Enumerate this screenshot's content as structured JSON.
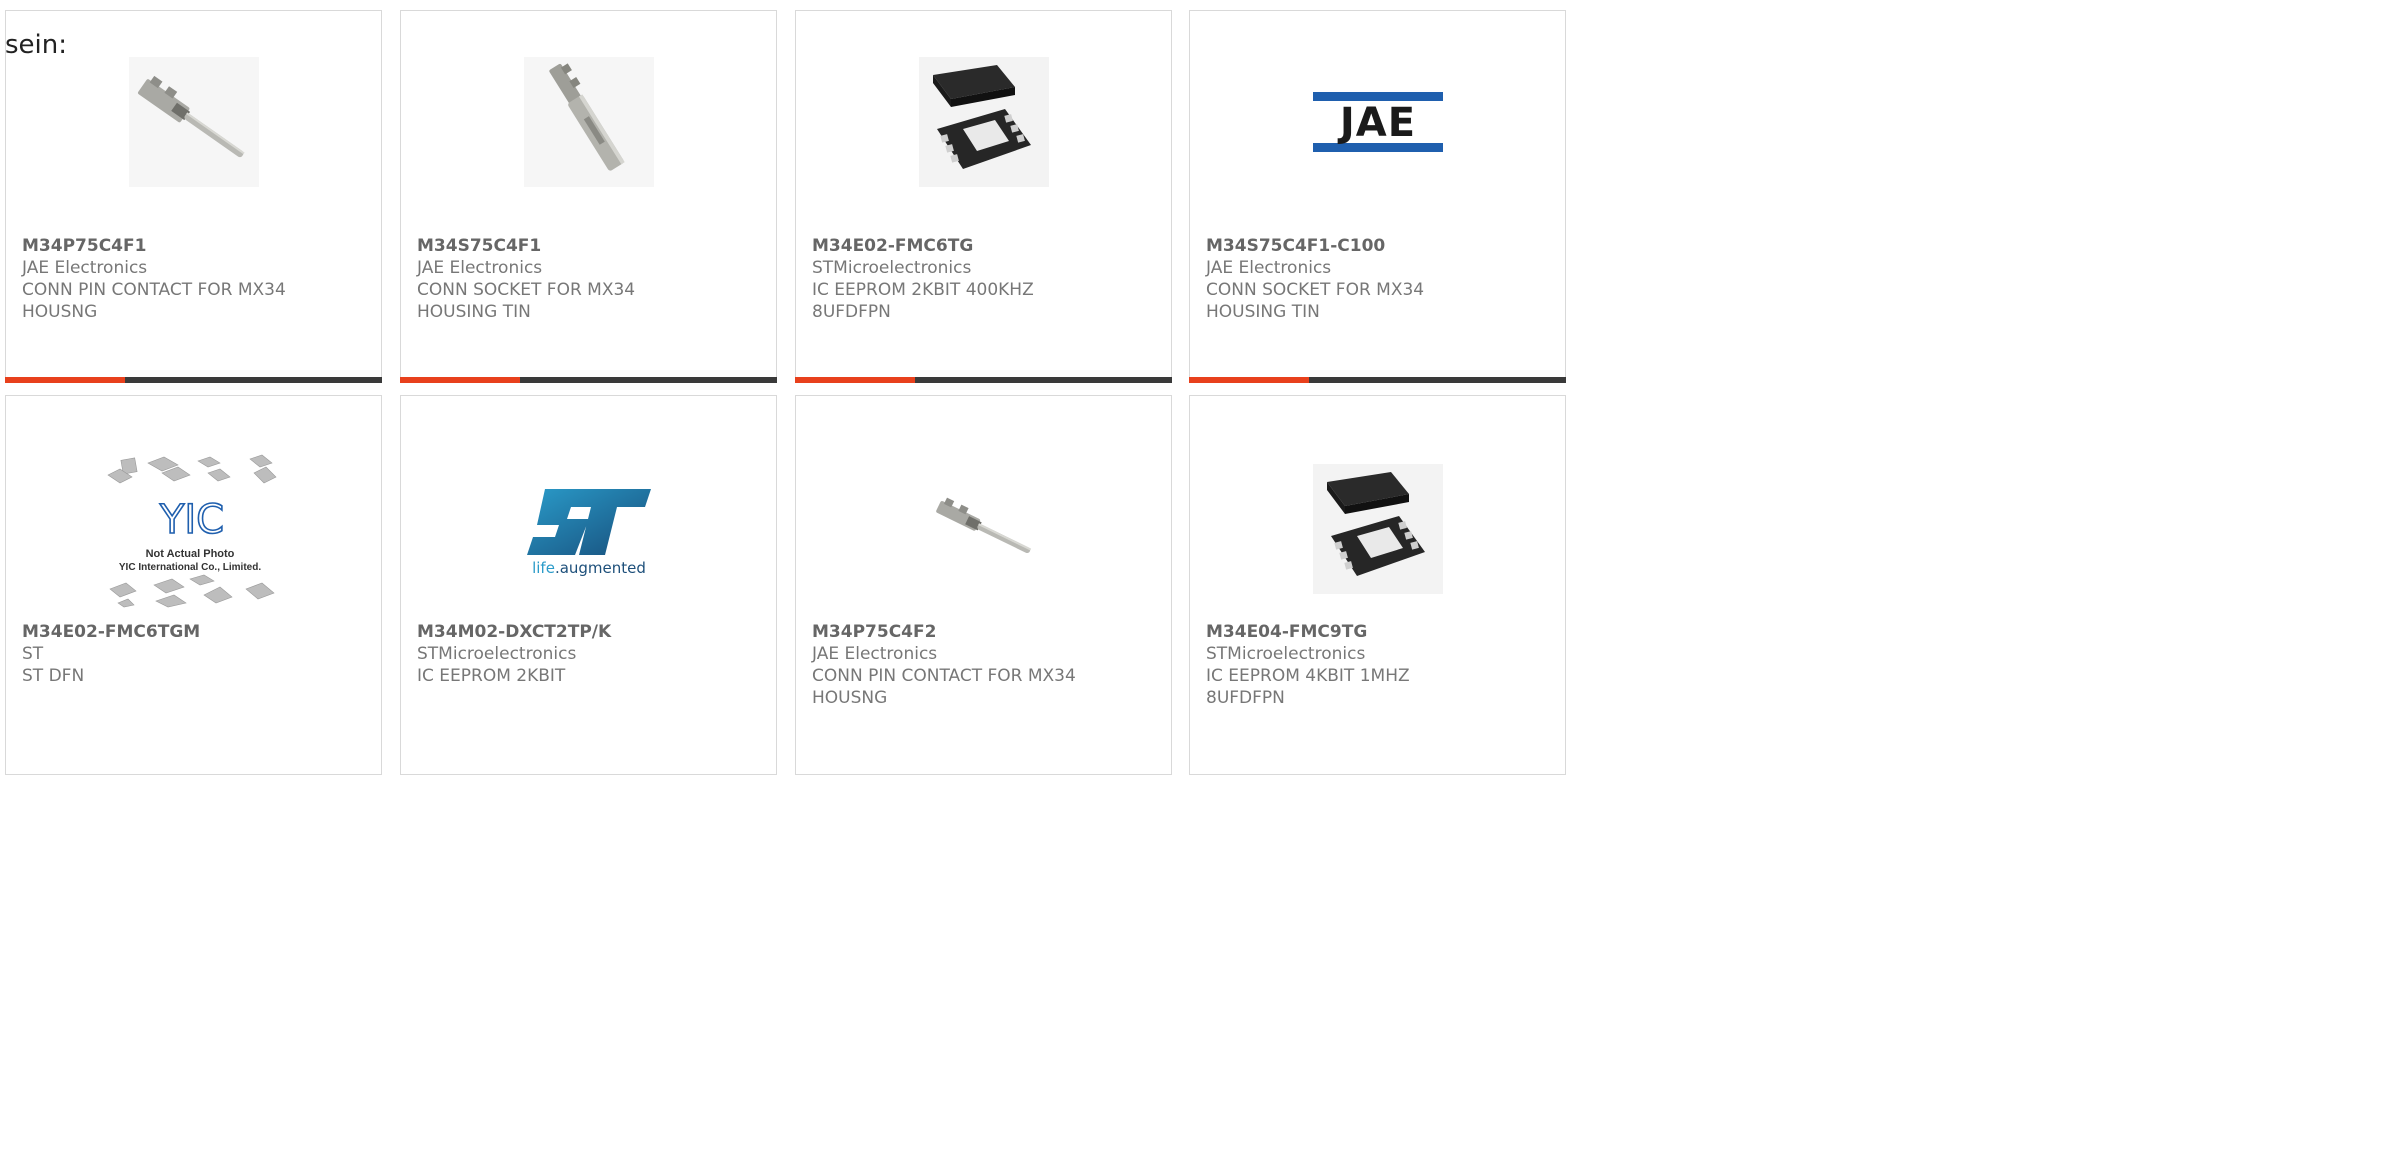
{
  "intro_text": "sein:",
  "accent_color": "#e8401c",
  "bar_color": "#3a3a3a",
  "products": [
    {
      "part": "M34P75C4F1",
      "maker": "JAE Electronics",
      "desc": "CONN PIN CONTACT FOR MX34\nHOUSNG",
      "image": "pin-contact-icon"
    },
    {
      "part": "M34S75C4F1",
      "maker": "JAE Electronics",
      "desc": "CONN SOCKET FOR MX34\nHOUSING TIN",
      "image": "socket-contact-icon"
    },
    {
      "part": "M34E02-FMC6TG",
      "maker": "STMicroelectronics",
      "desc": "IC EEPROM 2KBIT 400KHZ\n8UFDFPN",
      "image": "dfn-chip-icon"
    },
    {
      "part": "M34S75C4F1-C100",
      "maker": "JAE Electronics",
      "desc": "CONN SOCKET FOR MX34\nHOUSING TIN",
      "image": "jae-logo",
      "logo_text": "JAE"
    },
    {
      "part": "M34E02-FMC6TGM",
      "maker": "ST",
      "desc": "ST DFN",
      "image": "yic-placeholder",
      "logo_text": "YIC",
      "note1": "Not Actual Photo",
      "note2": "YIC International Co., Limited."
    },
    {
      "part": "M34M02-DXCT2TP/K",
      "maker": "STMicroelectronics",
      "desc": "IC EEPROM 2KBIT",
      "image": "st-logo",
      "logo_text": "ST",
      "tagline_a": "life",
      "tagline_b": ".augmented"
    },
    {
      "part": "M34P75C4F2",
      "maker": "JAE Electronics",
      "desc": "CONN PIN CONTACT FOR MX34\nHOUSNG",
      "image": "pin-contact-icon"
    },
    {
      "part": "M34E04-FMC9TG",
      "maker": "STMicroelectronics",
      "desc": "IC EEPROM 4KBIT 1MHZ\n8UFDFPN",
      "image": "dfn-chip-icon"
    }
  ]
}
